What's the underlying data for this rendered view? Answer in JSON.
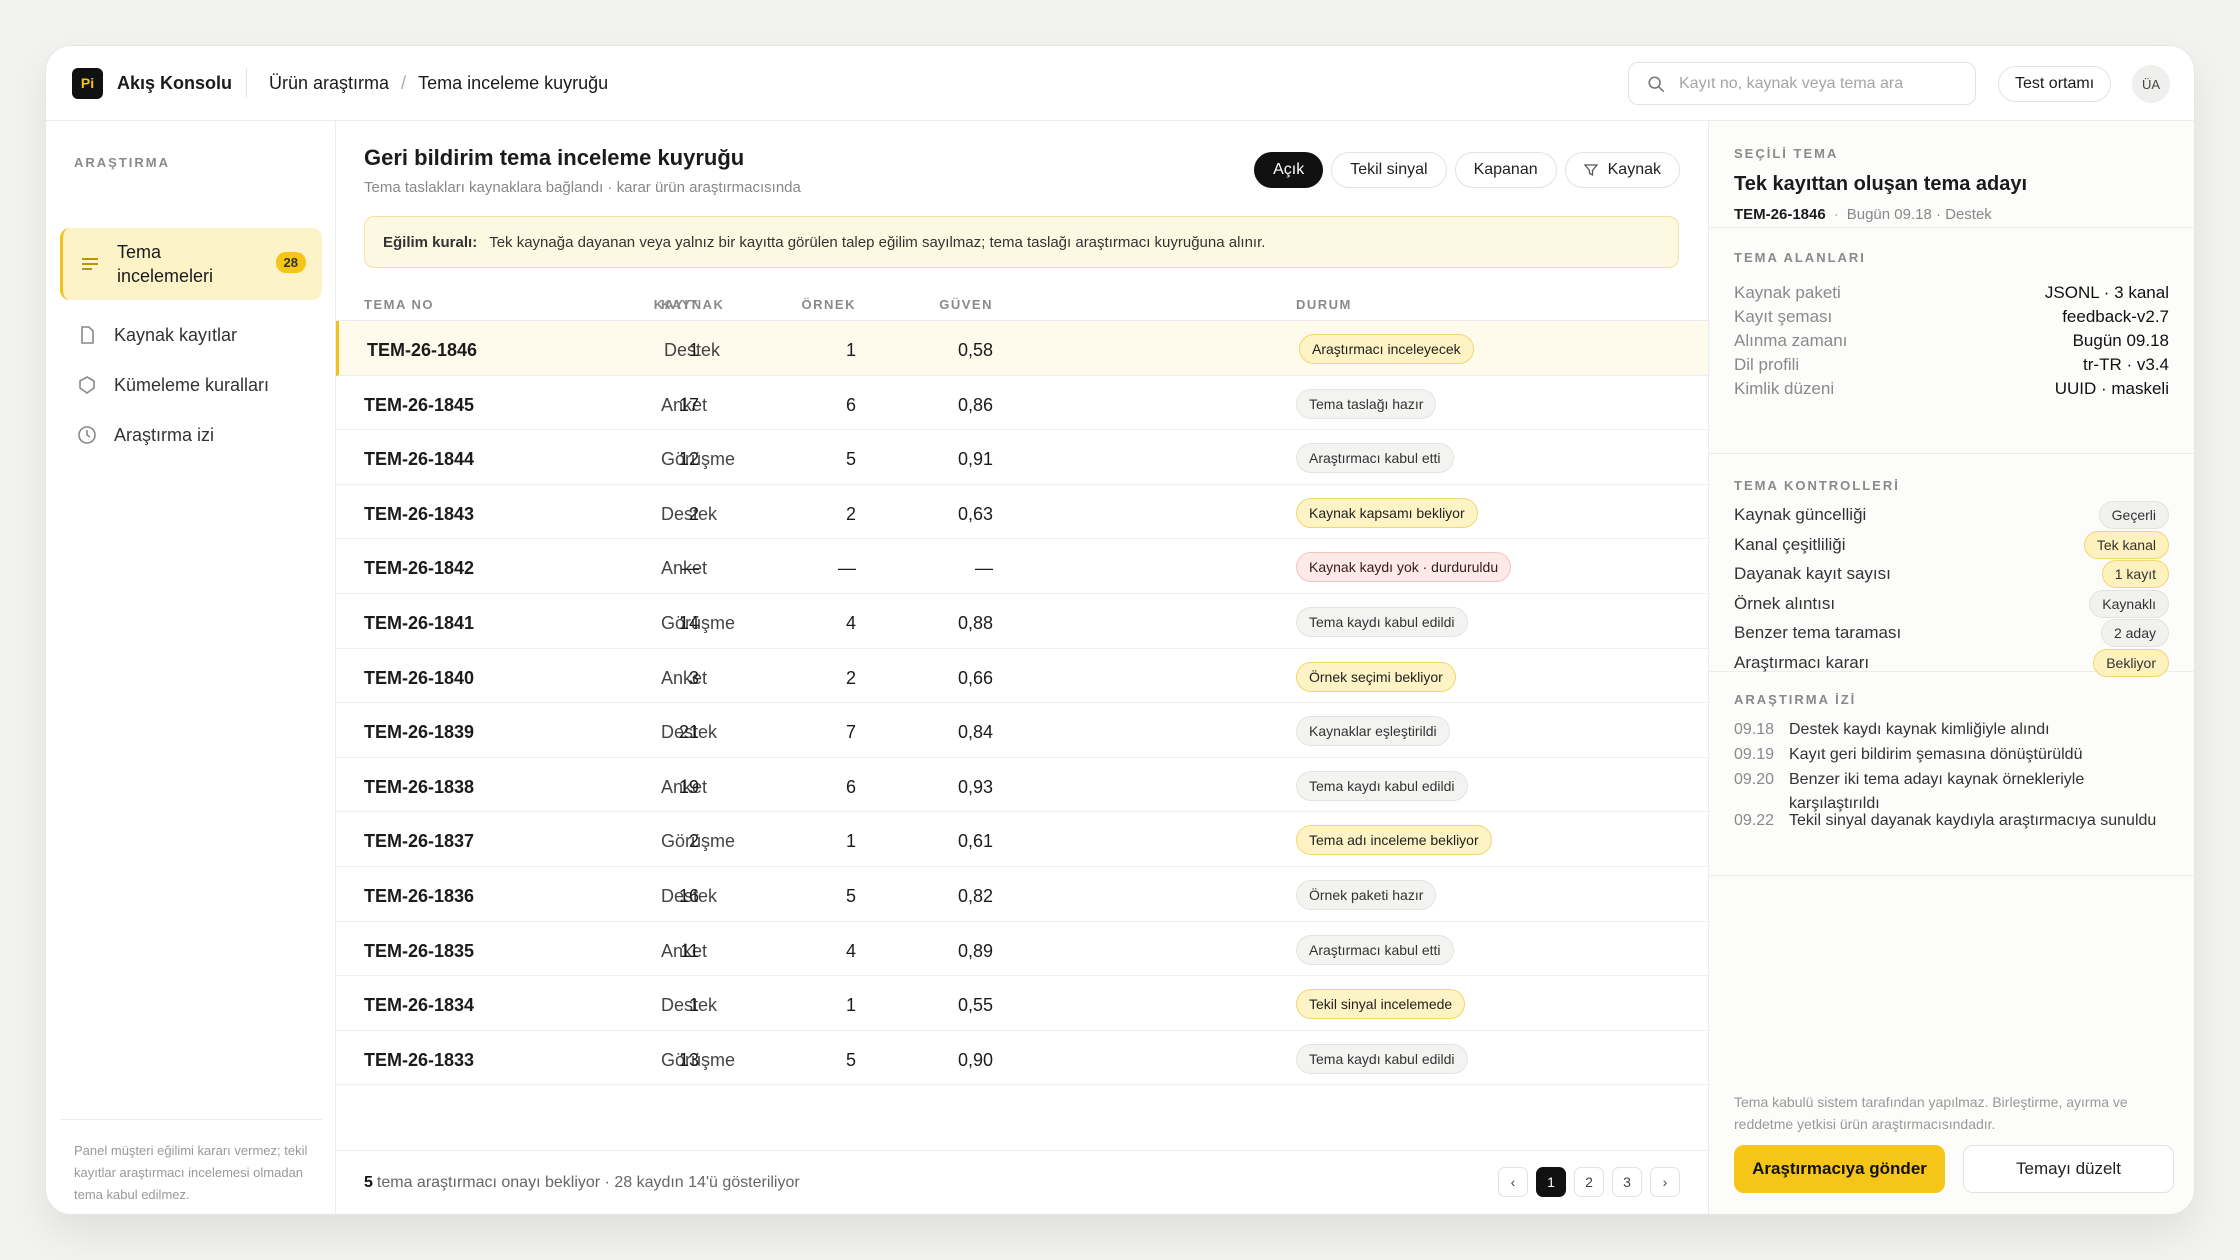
{
  "brand": {
    "logo": "Pi",
    "name": "Akış Konsolu"
  },
  "breadcrumb": [
    "Ürün araştırma",
    "Tema inceleme kuyruğu"
  ],
  "search": {
    "placeholder": "Kayıt no, kaynak veya tema ara"
  },
  "env_button": "Test ortamı",
  "avatar": "ÜA",
  "sidebar": {
    "section": "ARAŞTIRMA",
    "items": [
      {
        "label": "Tema incelemeleri",
        "badge": "28",
        "icon": "list-icon"
      },
      {
        "label": "Kaynak kayıtlar",
        "icon": "document-icon"
      },
      {
        "label": "Kümeleme kuralları",
        "icon": "shield-icon"
      },
      {
        "label": "Araştırma izi",
        "icon": "clock-icon"
      }
    ],
    "footnote": "Panel müşteri eğilimi kararı vermez; tekil kayıtlar araştırmacı incelemesi olmadan tema kabul edilmez."
  },
  "main": {
    "title": "Geri bildirim tema inceleme kuyruğu",
    "subtitle": "Tema taslakları kaynaklara bağlandı · karar ürün araştırmacısında",
    "filters": [
      "Açık",
      "Tekil sinyal",
      "Kapanan",
      "Kaynak"
    ],
    "rule_label": "Eğilim kuralı:",
    "rule_text": "Tek kaynağa dayanan veya yalnız bir kayıtta görülen talep eğilim sayılmaz; tema taslağı araştırmacı kuyruğuna alınır.",
    "columns": [
      "TEMA NO",
      "KAYNAK",
      "KAYIT",
      "ÖRNEK",
      "GÜVEN",
      "DURUM"
    ],
    "rows": [
      {
        "no": "TEM-26-1846",
        "src": "Destek",
        "kayit": "1",
        "ornek": "1",
        "guven": "0,58",
        "status": "Araştırmacı inceleyecek",
        "tone": "yellow"
      },
      {
        "no": "TEM-26-1845",
        "src": "Anket",
        "kayit": "17",
        "ornek": "6",
        "guven": "0,86",
        "status": "Tema taslağı hazır",
        "tone": "gray"
      },
      {
        "no": "TEM-26-1844",
        "src": "Görüşme",
        "kayit": "12",
        "ornek": "5",
        "guven": "0,91",
        "status": "Araştırmacı kabul etti",
        "tone": "gray"
      },
      {
        "no": "TEM-26-1843",
        "src": "Destek",
        "kayit": "2",
        "ornek": "2",
        "guven": "0,63",
        "status": "Kaynak kapsamı bekliyor",
        "tone": "yellow"
      },
      {
        "no": "TEM-26-1842",
        "src": "Anket",
        "kayit": "—",
        "ornek": "—",
        "guven": "—",
        "status": "Kaynak kaydı yok · durduruldu",
        "tone": "red"
      },
      {
        "no": "TEM-26-1841",
        "src": "Görüşme",
        "kayit": "14",
        "ornek": "4",
        "guven": "0,88",
        "status": "Tema kaydı kabul edildi",
        "tone": "gray"
      },
      {
        "no": "TEM-26-1840",
        "src": "Anket",
        "kayit": "3",
        "ornek": "2",
        "guven": "0,66",
        "status": "Örnek seçimi bekliyor",
        "tone": "yellow"
      },
      {
        "no": "TEM-26-1839",
        "src": "Destek",
        "kayit": "21",
        "ornek": "7",
        "guven": "0,84",
        "status": "Kaynaklar eşleştirildi",
        "tone": "gray"
      },
      {
        "no": "TEM-26-1838",
        "src": "Anket",
        "kayit": "19",
        "ornek": "6",
        "guven": "0,93",
        "status": "Tema kaydı kabul edildi",
        "tone": "gray"
      },
      {
        "no": "TEM-26-1837",
        "src": "Görüşme",
        "kayit": "2",
        "ornek": "1",
        "guven": "0,61",
        "status": "Tema adı inceleme bekliyor",
        "tone": "yellow"
      },
      {
        "no": "TEM-26-1836",
        "src": "Destek",
        "kayit": "16",
        "ornek": "5",
        "guven": "0,82",
        "status": "Örnek paketi hazır",
        "tone": "gray"
      },
      {
        "no": "TEM-26-1835",
        "src": "Anket",
        "kayit": "11",
        "ornek": "4",
        "guven": "0,89",
        "status": "Araştırmacı kabul etti",
        "tone": "gray"
      },
      {
        "no": "TEM-26-1834",
        "src": "Destek",
        "kayit": "1",
        "ornek": "1",
        "guven": "0,55",
        "status": "Tekil sinyal incelemede",
        "tone": "yellow"
      },
      {
        "no": "TEM-26-1833",
        "src": "Görüşme",
        "kayit": "13",
        "ornek": "5",
        "guven": "0,90",
        "status": "Tema kaydı kabul edildi",
        "tone": "gray"
      }
    ],
    "footer_count": "5",
    "footer_text": "tema araştırmacı onayı bekliyor · 28 kaydın 14'ü gösteriliyor",
    "pages": [
      "1",
      "2",
      "3"
    ],
    "prev": "‹",
    "next": "›"
  },
  "panel": {
    "section_label": "SEÇİLİ TEMA",
    "title": "Tek kayıttan oluşan tema adayı",
    "id": "TEM-26-1846",
    "meta": "Bugün 09.18 · Destek",
    "fields_label": "TEMA ALANLARI",
    "fields": [
      {
        "k": "Kaynak paketi",
        "v": "JSONL · 3 kanal"
      },
      {
        "k": "Kayıt şeması",
        "v": "feedback-v2.7"
      },
      {
        "k": "Alınma zamanı",
        "v": "Bugün 09.18"
      },
      {
        "k": "Dil profili",
        "v": "tr-TR · v3.4"
      },
      {
        "k": "Kimlik düzeni",
        "v": "UUID · maskeli"
      }
    ],
    "controls_label": "TEMA KONTROLLERİ",
    "controls": [
      {
        "k": "Kaynak güncelliği",
        "v": "Geçerli",
        "tone": "gray"
      },
      {
        "k": "Kanal çeşitliliği",
        "v": "Tek kanal",
        "tone": "yellow"
      },
      {
        "k": "Dayanak kayıt sayısı",
        "v": "1 kayıt",
        "tone": "yellow"
      },
      {
        "k": "Örnek alıntısı",
        "v": "Kaynaklı",
        "tone": "gray"
      },
      {
        "k": "Benzer tema taraması",
        "v": "2 aday",
        "tone": "gray"
      },
      {
        "k": "Araştırmacı kararı",
        "v": "Bekliyor",
        "tone": "yellow"
      }
    ],
    "log_label": "ARAŞTIRMA İZİ",
    "log": [
      {
        "t": "09.18",
        "text": "Destek kaydı kaynak kimliğiyle alındı"
      },
      {
        "t": "09.19",
        "text": "Kayıt geri bildirim şemasına dönüştürüldü"
      },
      {
        "t": "09.20",
        "text": "Benzer iki tema adayı kaynak örnekleriyle karşılaştırıldı"
      },
      {
        "t": "09.22",
        "text": "Tekil sinyal dayanak kaydıyla araştırmacıya sunuldu"
      }
    ],
    "note": "Tema kabulü sistem tarafından yapılmaz. Birleştirme, ayırma ve reddetme yetkisi ürün araştırmacısındadır.",
    "primary": "Araştırmacıya gönder",
    "secondary": "Temayı düzelt"
  }
}
